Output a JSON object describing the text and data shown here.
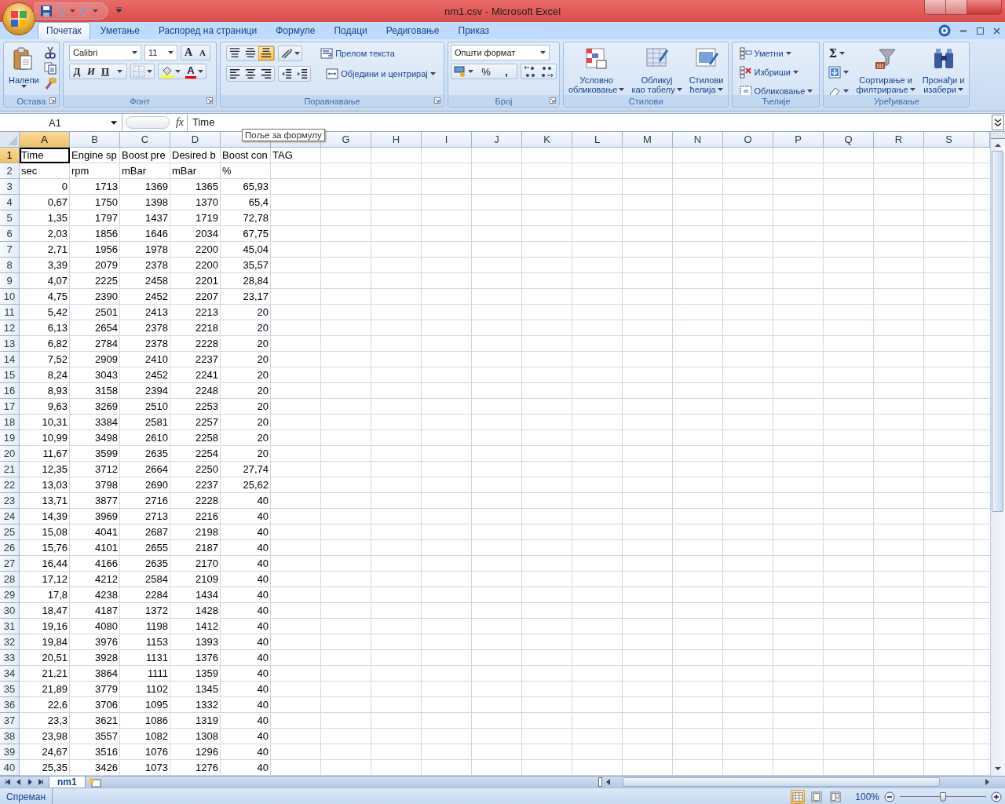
{
  "window": {
    "title": "nm1.csv - Microsoft Excel"
  },
  "ribbon_tabs": [
    {
      "label": "Почетак",
      "selected": true
    },
    {
      "label": "Уметање",
      "selected": false
    },
    {
      "label": "Распоред на страници",
      "selected": false
    },
    {
      "label": "Формуле",
      "selected": false
    },
    {
      "label": "Подаци",
      "selected": false
    },
    {
      "label": "Редиговање",
      "selected": false
    },
    {
      "label": "Приказ",
      "selected": false
    }
  ],
  "clipboard": {
    "title": "Остава",
    "paste": "Налепи"
  },
  "font": {
    "title": "Фонт",
    "font_name": "Calibri",
    "font_size": "11",
    "grow": "A",
    "shrink": "A",
    "bold": "Д",
    "italic": "И",
    "underline": "П",
    "font_color": "A"
  },
  "alignment": {
    "title": "Поравнавање",
    "vertical_align": [
      {
        "selected": false
      },
      {
        "selected": false
      },
      {
        "selected": true
      }
    ],
    "wrap_text": "Прелом текста",
    "merge_center": "Обједини и центрирај"
  },
  "number": {
    "title": "Број",
    "format": "Општи формат",
    "percent": "%",
    "comma": ","
  },
  "styles": {
    "title": "Стилови",
    "buttons": [
      {
        "line1": "Условно",
        "line2": "обликовање"
      },
      {
        "line1": "Обликуј",
        "line2": "као табелу"
      },
      {
        "line1": "Стилови",
        "line2": "ћелија"
      }
    ]
  },
  "cells": {
    "title": "Ћелије",
    "buttons": [
      "Уметни",
      "Избриши",
      "Обликовање"
    ]
  },
  "editing": {
    "title": "Уређивање",
    "sum": "Σ",
    "buttons": [
      {
        "line1": "Сортирање и",
        "line2": "филтрирање"
      },
      {
        "line1": "Пронађи и",
        "line2": "изабери"
      }
    ]
  },
  "formula_bar": {
    "name_box": "A1",
    "function_label": "fx",
    "formula": "Time",
    "tooltip": "Поље за формулу"
  },
  "columns": [
    {
      "label": "A",
      "selected": true
    },
    {
      "label": "B",
      "selected": false
    },
    {
      "label": "C",
      "selected": false
    },
    {
      "label": "D",
      "selected": false
    },
    {
      "selected": false
    },
    {
      "selected": false
    },
    {
      "label": "G",
      "selected": false
    },
    {
      "label": "H",
      "selected": false
    },
    {
      "label": "I",
      "selected": false
    },
    {
      "label": "J",
      "selected": false
    },
    {
      "label": "K",
      "selected": false
    },
    {
      "label": "L",
      "selected": false
    },
    {
      "label": "M",
      "selected": false
    },
    {
      "label": "N",
      "selected": false
    },
    {
      "label": "O",
      "selected": false
    },
    {
      "label": "P",
      "selected": false
    },
    {
      "label": "Q",
      "selected": false
    },
    {
      "label": "R",
      "selected": false
    },
    {
      "label": "S",
      "selected": false
    }
  ],
  "rows": [
    {
      "number": "1",
      "selected": true,
      "kind": "text",
      "cells": [
        "Time",
        "Engine sp",
        "Boost pre",
        "Desired b",
        "Boost con",
        "TAG"
      ]
    },
    {
      "number": "2",
      "selected": false,
      "kind": "text",
      "cells": [
        "sec",
        "rpm",
        "mBar",
        "mBar",
        "%"
      ]
    },
    {
      "number": "3",
      "selected": false,
      "kind": "number",
      "cells": [
        "0",
        "1713",
        "1369",
        "1365",
        "65,93"
      ]
    },
    {
      "number": "4",
      "selected": false,
      "kind": "number",
      "cells": [
        "0,67",
        "1750",
        "1398",
        "1370",
        "65,4"
      ]
    },
    {
      "number": "5",
      "selected": false,
      "kind": "number",
      "cells": [
        "1,35",
        "1797",
        "1437",
        "1719",
        "72,78"
      ]
    },
    {
      "number": "6",
      "selected": false,
      "kind": "number",
      "cells": [
        "2,03",
        "1856",
        "1646",
        "2034",
        "67,75"
      ]
    },
    {
      "number": "7",
      "selected": false,
      "kind": "number",
      "cells": [
        "2,71",
        "1956",
        "1978",
        "2200",
        "45,04"
      ]
    },
    {
      "number": "8",
      "selected": false,
      "kind": "number",
      "cells": [
        "3,39",
        "2079",
        "2378",
        "2200",
        "35,57"
      ]
    },
    {
      "number": "9",
      "selected": false,
      "kind": "number",
      "cells": [
        "4,07",
        "2225",
        "2458",
        "2201",
        "28,84"
      ]
    },
    {
      "number": "10",
      "selected": false,
      "kind": "number",
      "cells": [
        "4,75",
        "2390",
        "2452",
        "2207",
        "23,17"
      ]
    },
    {
      "number": "11",
      "selected": false,
      "kind": "number",
      "cells": [
        "5,42",
        "2501",
        "2413",
        "2213",
        "20"
      ]
    },
    {
      "number": "12",
      "selected": false,
      "kind": "number",
      "cells": [
        "6,13",
        "2654",
        "2378",
        "2218",
        "20"
      ]
    },
    {
      "number": "13",
      "selected": false,
      "kind": "number",
      "cells": [
        "6,82",
        "2784",
        "2378",
        "2228",
        "20"
      ]
    },
    {
      "number": "14",
      "selected": false,
      "kind": "number",
      "cells": [
        "7,52",
        "2909",
        "2410",
        "2237",
        "20"
      ]
    },
    {
      "number": "15",
      "selected": false,
      "kind": "number",
      "cells": [
        "8,24",
        "3043",
        "2452",
        "2241",
        "20"
      ]
    },
    {
      "number": "16",
      "selected": false,
      "kind": "number",
      "cells": [
        "8,93",
        "3158",
        "2394",
        "2248",
        "20"
      ]
    },
    {
      "number": "17",
      "selected": false,
      "kind": "number",
      "cells": [
        "9,63",
        "3269",
        "2510",
        "2253",
        "20"
      ]
    },
    {
      "number": "18",
      "selected": false,
      "kind": "number",
      "cells": [
        "10,31",
        "3384",
        "2581",
        "2257",
        "20"
      ]
    },
    {
      "number": "19",
      "selected": false,
      "kind": "number",
      "cells": [
        "10,99",
        "3498",
        "2610",
        "2258",
        "20"
      ]
    },
    {
      "number": "20",
      "selected": false,
      "kind": "number",
      "cells": [
        "11,67",
        "3599",
        "2635",
        "2254",
        "20"
      ]
    },
    {
      "number": "21",
      "selected": false,
      "kind": "number",
      "cells": [
        "12,35",
        "3712",
        "2664",
        "2250",
        "27,74"
      ]
    },
    {
      "number": "22",
      "selected": false,
      "kind": "number",
      "cells": [
        "13,03",
        "3798",
        "2690",
        "2237",
        "25,62"
      ]
    },
    {
      "number": "23",
      "selected": false,
      "kind": "number",
      "cells": [
        "13,71",
        "3877",
        "2716",
        "2228",
        "40"
      ]
    },
    {
      "number": "24",
      "selected": false,
      "kind": "number",
      "cells": [
        "14,39",
        "3969",
        "2713",
        "2216",
        "40"
      ]
    },
    {
      "number": "25",
      "selected": false,
      "kind": "number",
      "cells": [
        "15,08",
        "4041",
        "2687",
        "2198",
        "40"
      ]
    },
    {
      "number": "26",
      "selected": false,
      "kind": "number",
      "cells": [
        "15,76",
        "4101",
        "2655",
        "2187",
        "40"
      ]
    },
    {
      "number": "27",
      "selected": false,
      "kind": "number",
      "cells": [
        "16,44",
        "4166",
        "2635",
        "2170",
        "40"
      ]
    },
    {
      "number": "28",
      "selected": false,
      "kind": "number",
      "cells": [
        "17,12",
        "4212",
        "2584",
        "2109",
        "40"
      ]
    },
    {
      "number": "29",
      "selected": false,
      "kind": "number",
      "cells": [
        "17,8",
        "4238",
        "2284",
        "1434",
        "40"
      ]
    },
    {
      "number": "30",
      "selected": false,
      "kind": "number",
      "cells": [
        "18,47",
        "4187",
        "1372",
        "1428",
        "40"
      ]
    },
    {
      "number": "31",
      "selected": false,
      "kind": "number",
      "cells": [
        "19,16",
        "4080",
        "1198",
        "1412",
        "40"
      ]
    },
    {
      "number": "32",
      "selected": false,
      "kind": "number",
      "cells": [
        "19,84",
        "3976",
        "1153",
        "1393",
        "40"
      ]
    },
    {
      "number": "33",
      "selected": false,
      "kind": "number",
      "cells": [
        "20,51",
        "3928",
        "1131",
        "1376",
        "40"
      ]
    },
    {
      "number": "34",
      "selected": false,
      "kind": "number",
      "cells": [
        "21,21",
        "3864",
        "1111",
        "1359",
        "40"
      ]
    },
    {
      "number": "35",
      "selected": false,
      "kind": "number",
      "cells": [
        "21,89",
        "3779",
        "1102",
        "1345",
        "40"
      ]
    },
    {
      "number": "36",
      "selected": false,
      "kind": "number",
      "cells": [
        "22,6",
        "3706",
        "1095",
        "1332",
        "40"
      ]
    },
    {
      "number": "37",
      "selected": false,
      "kind": "number",
      "cells": [
        "23,3",
        "3621",
        "1086",
        "1319",
        "40"
      ]
    },
    {
      "number": "38",
      "selected": false,
      "kind": "number",
      "cells": [
        "23,98",
        "3557",
        "1082",
        "1308",
        "40"
      ]
    },
    {
      "number": "39",
      "selected": false,
      "kind": "number",
      "cells": [
        "24,67",
        "3516",
        "1076",
        "1296",
        "40"
      ]
    },
    {
      "number": "40",
      "selected": false,
      "kind": "number",
      "cells": [
        "25,35",
        "3426",
        "1073",
        "1276",
        "40"
      ]
    }
  ],
  "sheet_tabs": [
    {
      "label": "nm1",
      "selected": true
    }
  ],
  "status_bar": {
    "status": "Спреман",
    "views": [
      {
        "selected": true
      },
      {
        "selected": false
      },
      {
        "selected": false
      }
    ],
    "zoom": "100%",
    "zoom_level": {
      "level": 0.5
    }
  }
}
